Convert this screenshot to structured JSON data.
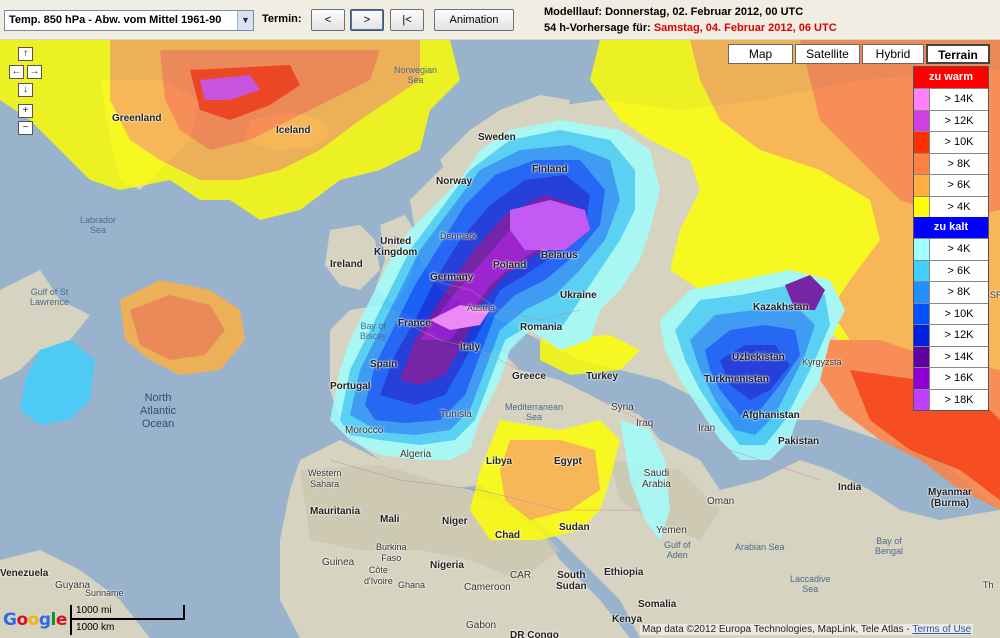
{
  "toolbar": {
    "parameter_select": "Temp. 850 hPa - Abw. vom Mittel 1961-90",
    "termin_label": "Termin:",
    "btn_prev": "<",
    "btn_next": ">",
    "btn_first": "|<",
    "btn_animation": "Animation",
    "modelllauf": "Modelllauf: Donnerstag, 02. Februar 2012, 00 UTC",
    "forecast_prefix": "54 h-Vorhersage für: ",
    "forecast_date": "Samstag, 04. Februar 2012, 06 UTC"
  },
  "map_types": [
    "Map",
    "Satellite",
    "Hybrid",
    "Terrain"
  ],
  "selected_map_type": "Terrain",
  "nav": {
    "up": "↑",
    "left": "←",
    "right": "→",
    "down": "↓",
    "zoom_in": "+",
    "zoom_out": "−"
  },
  "legend": {
    "warm_header": "zu warm",
    "cold_header": "zu kalt",
    "warm_color": "#ff0000",
    "cold_color": "#0000ff",
    "warm": [
      {
        "label": "> 14K",
        "color": "#ff80ff"
      },
      {
        "label": "> 12K",
        "color": "#d040e0"
      },
      {
        "label": "> 10K",
        "color": "#ff3000"
      },
      {
        "label": "> 8K",
        "color": "#ff8040"
      },
      {
        "label": "> 6K",
        "color": "#ffb040"
      },
      {
        "label": "> 4K",
        "color": "#ffff00"
      }
    ],
    "cold": [
      {
        "label": "> 4K",
        "color": "#a0ffff"
      },
      {
        "label": "> 6K",
        "color": "#40d0ff"
      },
      {
        "label": "> 8K",
        "color": "#2090ff"
      },
      {
        "label": "> 10K",
        "color": "#0050ff"
      },
      {
        "label": "> 12K",
        "color": "#0020e0"
      },
      {
        "label": "> 14K",
        "color": "#6000a0"
      },
      {
        "label": "> 16K",
        "color": "#9000d0"
      },
      {
        "label": "> 18K",
        "color": "#c040ff"
      }
    ]
  },
  "labels": {
    "greenland": "Greenland",
    "iceland": "Iceland",
    "norwegian_sea": "Norwegian\nSea",
    "labrador_sea": "Labrador\nSea",
    "sweden": "Sweden",
    "finland": "Finland",
    "norway": "Norway",
    "denmark": "Denmark",
    "united_kingdom": "United\nKingdom",
    "ireland": "Ireland",
    "germany": "Germany",
    "poland": "Poland",
    "belarus": "Belarus",
    "ukraine": "Ukraine",
    "austria": "Austria",
    "france": "France",
    "bay_of_biscay": "Bay of\nBiscay",
    "romania": "Romania",
    "italy": "Italy",
    "spain": "Spain",
    "portugal": "Portugal",
    "greece": "Greece",
    "turkey": "Turkey",
    "mediterranean": "Mediterranean\nSea",
    "tunisia": "Tunisia",
    "morocco": "Morocco",
    "algeria": "Algeria",
    "libya": "Libya",
    "egypt": "Egypt",
    "syria": "Syria",
    "iraq": "Iraq",
    "iran": "Iran",
    "kazakhstan": "Kazakhstan",
    "uzbekistan": "Uzbekistan",
    "turkmenistan": "Turkmenistan",
    "kyrgyzstan": "Kyrgyzsta",
    "afghanistan": "Afghanistan",
    "pakistan": "Pakistan",
    "india": "India",
    "saudi_arabia": "Saudi\nArabia",
    "oman": "Oman",
    "yemen": "Yemen",
    "gulf_of_aden": "Gulf of\nAden",
    "arabian_sea": "Arabian Sea",
    "bay_of_bengal": "Bay of\nBengal",
    "laccadive_sea": "Laccadive\nSea",
    "myanmar": "Myanmar\n(Burma)",
    "western_sahara": "Western\nSahara",
    "mauritania": "Mauritania",
    "mali": "Mali",
    "niger": "Niger",
    "chad": "Chad",
    "sudan": "Sudan",
    "south_sudan": "South\nSudan",
    "ethiopia": "Ethiopia",
    "burkina_faso": "Burkina\nFaso",
    "guinea": "Guinea",
    "nigeria": "Nigeria",
    "cote_divoire": "Côte\nd'Ivoire",
    "ghana": "Ghana",
    "cameroon": "Cameroon",
    "car": "CAR",
    "kenya": "Kenya",
    "somalia": "Somalia",
    "dr_congo": "DR Congo",
    "gabon": "Gabon",
    "venezuela": "Venezuela",
    "guyana": "Guyana",
    "suriname": "Suriname",
    "gulf_of_st_lawrence": "Gulf of St\nLawrence",
    "north_atlantic": "North\nAtlantic\nOcean",
    "sr": "SR",
    "th": "Th"
  },
  "scale": {
    "miles": "1000 mi",
    "km": "1000 km"
  },
  "google": "Google",
  "copyright": "Map data ©2012 Europa Technologies, MapLink, Tele Atlas - ",
  "terms": "Terms of Use"
}
